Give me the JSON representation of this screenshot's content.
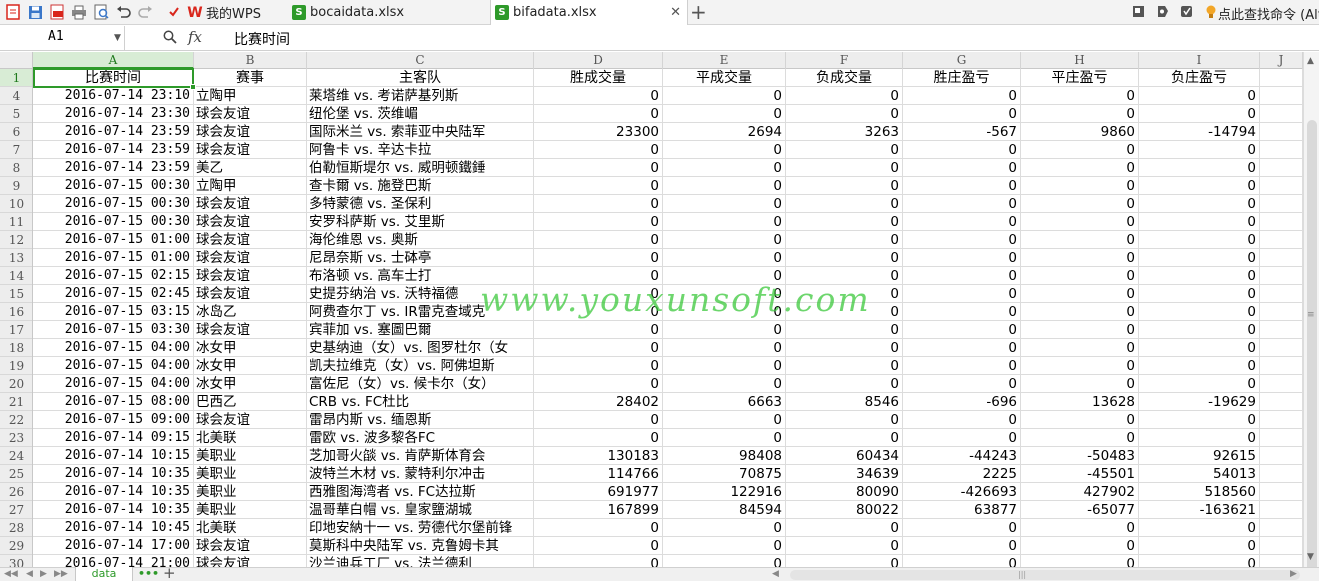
{
  "tabs": [
    {
      "label": "我的WPS",
      "icon": "wps-logo-icon",
      "active": false
    },
    {
      "label": "bocaidata.xlsx",
      "icon": "spreadsheet-file-icon",
      "active": false
    },
    {
      "label": "bifadata.xlsx",
      "icon": "spreadsheet-file-icon",
      "active": true
    }
  ],
  "help_search": "点此查找命令 (Alt-",
  "formula_bar": {
    "cell_ref": "A1",
    "fx": "fx",
    "content": "比赛时间"
  },
  "columns": [
    "A",
    "B",
    "C",
    "D",
    "E",
    "F",
    "G",
    "H",
    "I",
    "J"
  ],
  "header_row": {
    "row_num": "1",
    "cells": [
      "比赛时间",
      "赛事",
      "主客队",
      "胜成交量",
      "平成交量",
      "负成交量",
      "胜庄盈亏",
      "平庄盈亏",
      "负庄盈亏"
    ]
  },
  "rows": [
    {
      "n": "4",
      "cells": [
        "2016-07-14 23:10",
        "立陶甲",
        "莱塔维 vs. 考诺萨基列斯",
        "0",
        "0",
        "0",
        "0",
        "0",
        "0"
      ]
    },
    {
      "n": "5",
      "cells": [
        "2016-07-14 23:30",
        "球会友谊",
        "纽伦堡 vs. 茨维嵋",
        "0",
        "0",
        "0",
        "0",
        "0",
        "0"
      ]
    },
    {
      "n": "6",
      "cells": [
        "2016-07-14 23:59",
        "球会友谊",
        "国际米兰 vs. 索菲亚中央陆军",
        "23300",
        "2694",
        "3263",
        "-567",
        "9860",
        "-14794"
      ]
    },
    {
      "n": "7",
      "cells": [
        "2016-07-14 23:59",
        "球会友谊",
        "阿鲁卡 vs. 辛达卡拉",
        "0",
        "0",
        "0",
        "0",
        "0",
        "0"
      ]
    },
    {
      "n": "8",
      "cells": [
        "2016-07-14 23:59",
        "美乙",
        "伯勒恒斯堤尔 vs. 威明顿鐵錘",
        "0",
        "0",
        "0",
        "0",
        "0",
        "0"
      ]
    },
    {
      "n": "9",
      "cells": [
        "2016-07-15 00:30",
        "立陶甲",
        "查卡爾 vs. 施登巴斯",
        "0",
        "0",
        "0",
        "0",
        "0",
        "0"
      ]
    },
    {
      "n": "10",
      "cells": [
        "2016-07-15 00:30",
        "球会友谊",
        "多特蒙德 vs. 圣保利",
        "0",
        "0",
        "0",
        "0",
        "0",
        "0"
      ]
    },
    {
      "n": "11",
      "cells": [
        "2016-07-15 00:30",
        "球会友谊",
        "安罗科萨斯 vs. 艾里斯",
        "0",
        "0",
        "0",
        "0",
        "0",
        "0"
      ]
    },
    {
      "n": "12",
      "cells": [
        "2016-07-15 01:00",
        "球会友谊",
        "海伦维恩 vs. 奥斯",
        "0",
        "0",
        "0",
        "0",
        "0",
        "0"
      ]
    },
    {
      "n": "13",
      "cells": [
        "2016-07-15 01:00",
        "球会友谊",
        "尼昂奈斯 vs. 士砵亭",
        "0",
        "0",
        "0",
        "0",
        "0",
        "0"
      ]
    },
    {
      "n": "14",
      "cells": [
        "2016-07-15 02:15",
        "球会友谊",
        "布洛顿 vs. 高车士打",
        "0",
        "0",
        "0",
        "0",
        "0",
        "0"
      ]
    },
    {
      "n": "15",
      "cells": [
        "2016-07-15 02:45",
        "球会友谊",
        "史提芬纳治 vs. 沃特福德",
        "0",
        "0",
        "0",
        "0",
        "0",
        "0"
      ]
    },
    {
      "n": "16",
      "cells": [
        "2016-07-15 03:15",
        "冰岛乙",
        "阿费查尔丁 vs. IR雷克查域克",
        "0",
        "0",
        "0",
        "0",
        "0",
        "0"
      ]
    },
    {
      "n": "17",
      "cells": [
        "2016-07-15 03:30",
        "球会友谊",
        "宾菲加 vs. 塞圖巴爾",
        "0",
        "0",
        "0",
        "0",
        "0",
        "0"
      ]
    },
    {
      "n": "18",
      "cells": [
        "2016-07-15 04:00",
        "冰女甲",
        "史基纳迪（女）vs. 图罗杜尔（女",
        "0",
        "0",
        "0",
        "0",
        "0",
        "0"
      ]
    },
    {
      "n": "19",
      "cells": [
        "2016-07-15 04:00",
        "冰女甲",
        "凯夫拉维克（女）vs. 阿佛坦斯",
        "0",
        "0",
        "0",
        "0",
        "0",
        "0"
      ]
    },
    {
      "n": "20",
      "cells": [
        "2016-07-15 04:00",
        "冰女甲",
        "富佐尼（女）vs. 候卡尔（女）",
        "0",
        "0",
        "0",
        "0",
        "0",
        "0"
      ]
    },
    {
      "n": "21",
      "cells": [
        "2016-07-15 08:00",
        "巴西乙",
        "CRB vs. FC杜比",
        "28402",
        "6663",
        "8546",
        "-696",
        "13628",
        "-19629"
      ]
    },
    {
      "n": "22",
      "cells": [
        "2016-07-15 09:00",
        "球会友谊",
        "雷昂内斯 vs. 缅恩斯",
        "0",
        "0",
        "0",
        "0",
        "0",
        "0"
      ]
    },
    {
      "n": "23",
      "cells": [
        "2016-07-14 09:15",
        "北美联",
        "雷欧 vs. 波多黎各FC",
        "0",
        "0",
        "0",
        "0",
        "0",
        "0"
      ]
    },
    {
      "n": "24",
      "cells": [
        "2016-07-14 10:15",
        "美职业",
        "芝加哥火燄 vs. 肯萨斯体育会",
        "130183",
        "98408",
        "60434",
        "-44243",
        "-50483",
        "92615"
      ]
    },
    {
      "n": "25",
      "cells": [
        "2016-07-14 10:35",
        "美职业",
        "波特兰木材 vs. 蒙特利尔冲击",
        "114766",
        "70875",
        "34639",
        "2225",
        "-45501",
        "54013"
      ]
    },
    {
      "n": "26",
      "cells": [
        "2016-07-14 10:35",
        "美职业",
        "西雅图海湾者 vs. FC达拉斯",
        "691977",
        "122916",
        "80090",
        "-426693",
        "427902",
        "518560"
      ]
    },
    {
      "n": "27",
      "cells": [
        "2016-07-14 10:35",
        "美职业",
        "温哥華白帽 vs. 皇家鹽湖城",
        "167899",
        "84594",
        "80022",
        "63877",
        "-65077",
        "-163621"
      ]
    },
    {
      "n": "28",
      "cells": [
        "2016-07-14 10:45",
        "北美联",
        "印地安納十一 vs. 劳德代尔堡前锋",
        "0",
        "0",
        "0",
        "0",
        "0",
        "0"
      ]
    },
    {
      "n": "29",
      "cells": [
        "2016-07-14 17:00",
        "球会友谊",
        "莫斯科中央陆军 vs. 克鲁姆卡其",
        "0",
        "0",
        "0",
        "0",
        "0",
        "0"
      ]
    },
    {
      "n": "30",
      "cells": [
        "2016-07-14 21:00",
        "球会友谊",
        "沙兰迪兵工厂 vs. 法兰德利",
        "0",
        "0",
        "0",
        "0",
        "0",
        "0"
      ]
    }
  ],
  "watermark": "www.youxunsoft.com",
  "sheet_tab": "data",
  "sheet_more": "•••",
  "sheet_add": "+",
  "colors": {
    "accent": "#2e9a2a",
    "wps_red": "#d9261c"
  }
}
